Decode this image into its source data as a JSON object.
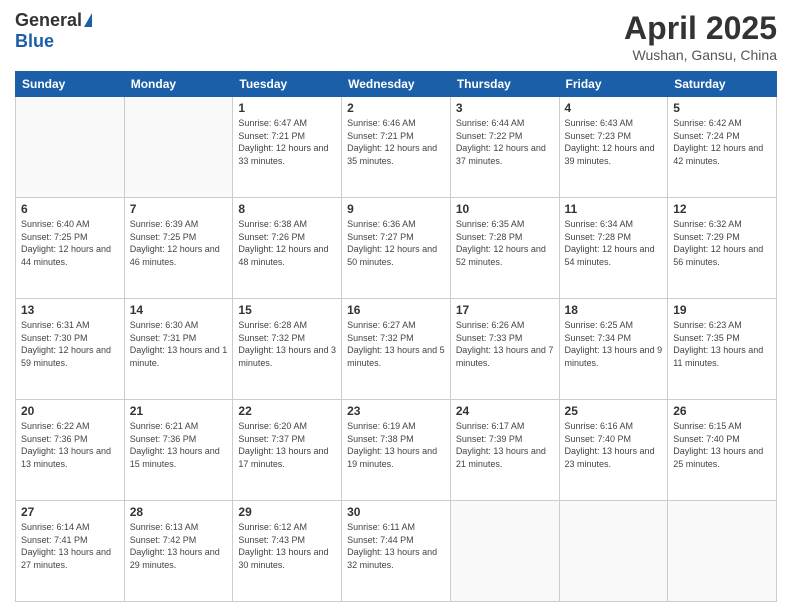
{
  "logo": {
    "general": "General",
    "blue": "Blue"
  },
  "title": {
    "month_year": "April 2025",
    "location": "Wushan, Gansu, China"
  },
  "weekdays": [
    "Sunday",
    "Monday",
    "Tuesday",
    "Wednesday",
    "Thursday",
    "Friday",
    "Saturday"
  ],
  "weeks": [
    [
      {
        "day": "",
        "info": ""
      },
      {
        "day": "",
        "info": ""
      },
      {
        "day": "1",
        "info": "Sunrise: 6:47 AM\nSunset: 7:21 PM\nDaylight: 12 hours and 33 minutes."
      },
      {
        "day": "2",
        "info": "Sunrise: 6:46 AM\nSunset: 7:21 PM\nDaylight: 12 hours and 35 minutes."
      },
      {
        "day": "3",
        "info": "Sunrise: 6:44 AM\nSunset: 7:22 PM\nDaylight: 12 hours and 37 minutes."
      },
      {
        "day": "4",
        "info": "Sunrise: 6:43 AM\nSunset: 7:23 PM\nDaylight: 12 hours and 39 minutes."
      },
      {
        "day": "5",
        "info": "Sunrise: 6:42 AM\nSunset: 7:24 PM\nDaylight: 12 hours and 42 minutes."
      }
    ],
    [
      {
        "day": "6",
        "info": "Sunrise: 6:40 AM\nSunset: 7:25 PM\nDaylight: 12 hours and 44 minutes."
      },
      {
        "day": "7",
        "info": "Sunrise: 6:39 AM\nSunset: 7:25 PM\nDaylight: 12 hours and 46 minutes."
      },
      {
        "day": "8",
        "info": "Sunrise: 6:38 AM\nSunset: 7:26 PM\nDaylight: 12 hours and 48 minutes."
      },
      {
        "day": "9",
        "info": "Sunrise: 6:36 AM\nSunset: 7:27 PM\nDaylight: 12 hours and 50 minutes."
      },
      {
        "day": "10",
        "info": "Sunrise: 6:35 AM\nSunset: 7:28 PM\nDaylight: 12 hours and 52 minutes."
      },
      {
        "day": "11",
        "info": "Sunrise: 6:34 AM\nSunset: 7:28 PM\nDaylight: 12 hours and 54 minutes."
      },
      {
        "day": "12",
        "info": "Sunrise: 6:32 AM\nSunset: 7:29 PM\nDaylight: 12 hours and 56 minutes."
      }
    ],
    [
      {
        "day": "13",
        "info": "Sunrise: 6:31 AM\nSunset: 7:30 PM\nDaylight: 12 hours and 59 minutes."
      },
      {
        "day": "14",
        "info": "Sunrise: 6:30 AM\nSunset: 7:31 PM\nDaylight: 13 hours and 1 minute."
      },
      {
        "day": "15",
        "info": "Sunrise: 6:28 AM\nSunset: 7:32 PM\nDaylight: 13 hours and 3 minutes."
      },
      {
        "day": "16",
        "info": "Sunrise: 6:27 AM\nSunset: 7:32 PM\nDaylight: 13 hours and 5 minutes."
      },
      {
        "day": "17",
        "info": "Sunrise: 6:26 AM\nSunset: 7:33 PM\nDaylight: 13 hours and 7 minutes."
      },
      {
        "day": "18",
        "info": "Sunrise: 6:25 AM\nSunset: 7:34 PM\nDaylight: 13 hours and 9 minutes."
      },
      {
        "day": "19",
        "info": "Sunrise: 6:23 AM\nSunset: 7:35 PM\nDaylight: 13 hours and 11 minutes."
      }
    ],
    [
      {
        "day": "20",
        "info": "Sunrise: 6:22 AM\nSunset: 7:36 PM\nDaylight: 13 hours and 13 minutes."
      },
      {
        "day": "21",
        "info": "Sunrise: 6:21 AM\nSunset: 7:36 PM\nDaylight: 13 hours and 15 minutes."
      },
      {
        "day": "22",
        "info": "Sunrise: 6:20 AM\nSunset: 7:37 PM\nDaylight: 13 hours and 17 minutes."
      },
      {
        "day": "23",
        "info": "Sunrise: 6:19 AM\nSunset: 7:38 PM\nDaylight: 13 hours and 19 minutes."
      },
      {
        "day": "24",
        "info": "Sunrise: 6:17 AM\nSunset: 7:39 PM\nDaylight: 13 hours and 21 minutes."
      },
      {
        "day": "25",
        "info": "Sunrise: 6:16 AM\nSunset: 7:40 PM\nDaylight: 13 hours and 23 minutes."
      },
      {
        "day": "26",
        "info": "Sunrise: 6:15 AM\nSunset: 7:40 PM\nDaylight: 13 hours and 25 minutes."
      }
    ],
    [
      {
        "day": "27",
        "info": "Sunrise: 6:14 AM\nSunset: 7:41 PM\nDaylight: 13 hours and 27 minutes."
      },
      {
        "day": "28",
        "info": "Sunrise: 6:13 AM\nSunset: 7:42 PM\nDaylight: 13 hours and 29 minutes."
      },
      {
        "day": "29",
        "info": "Sunrise: 6:12 AM\nSunset: 7:43 PM\nDaylight: 13 hours and 30 minutes."
      },
      {
        "day": "30",
        "info": "Sunrise: 6:11 AM\nSunset: 7:44 PM\nDaylight: 13 hours and 32 minutes."
      },
      {
        "day": "",
        "info": ""
      },
      {
        "day": "",
        "info": ""
      },
      {
        "day": "",
        "info": ""
      }
    ]
  ]
}
